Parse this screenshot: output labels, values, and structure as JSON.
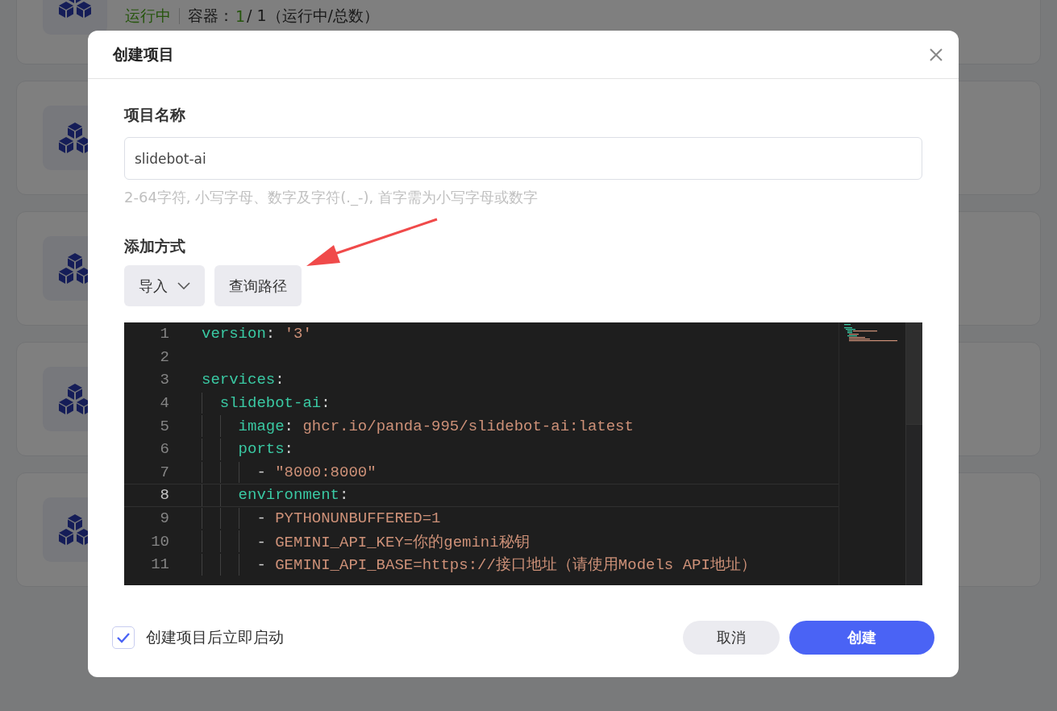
{
  "background": {
    "project_cards": [
      {
        "kind": "status",
        "status": "运行中",
        "containers_label": "容器：",
        "running": "1",
        "total": "/ 1（运行中/总数）"
      },
      {
        "kind": "hidden"
      },
      {
        "kind": "hidden"
      },
      {
        "kind": "hidden"
      },
      {
        "kind": "hidden"
      }
    ]
  },
  "dialog": {
    "title": "创建项目",
    "name_label": "项目名称",
    "name_value": "slidebot-ai",
    "name_hint": "2-64字符, 小写字母、数字及字符(._-), 首字需为小写字母或数字",
    "method_label": "添加方式",
    "import_button": "导入",
    "query_path_button": "查询路径",
    "editor": {
      "lines": [
        {
          "number": "1",
          "current": false,
          "tokens": [
            {
              "text": "version",
              "kind": "key"
            },
            {
              "text": ": ",
              "kind": "punct"
            },
            {
              "text": "'3'",
              "kind": "str"
            }
          ]
        },
        {
          "number": "2",
          "current": false
        },
        {
          "number": "3",
          "current": false,
          "tokens": [
            {
              "text": "services",
              "kind": "key"
            },
            {
              "text": ":",
              "kind": "punct"
            }
          ]
        },
        {
          "number": "4",
          "current": false,
          "tokens": [
            {
              "text": "  slidebot-ai",
              "kind": "key"
            },
            {
              "text": ":",
              "kind": "punct"
            }
          ]
        },
        {
          "number": "5",
          "current": false,
          "tokens": [
            {
              "text": "    image",
              "kind": "key"
            },
            {
              "text": ": ",
              "kind": "punct"
            },
            {
              "text": "ghcr.io/panda-995/slidebot-ai:latest",
              "kind": "str"
            }
          ]
        },
        {
          "number": "6",
          "current": false,
          "tokens": [
            {
              "text": "    ports",
              "kind": "key"
            },
            {
              "text": ":",
              "kind": "punct"
            }
          ]
        },
        {
          "number": "7",
          "current": false,
          "tokens": [
            {
              "text": "      - ",
              "kind": "punct"
            },
            {
              "text": "\"8000:8000\"",
              "kind": "str"
            }
          ]
        },
        {
          "number": "8",
          "current": true,
          "tokens": [
            {
              "text": "    environment",
              "kind": "key"
            },
            {
              "text": ":",
              "kind": "punct"
            }
          ]
        },
        {
          "number": "9",
          "current": false,
          "tokens": [
            {
              "text": "      - ",
              "kind": "punct"
            },
            {
              "text": "PYTHONUNBUFFERED=1",
              "kind": "str"
            }
          ]
        },
        {
          "number": "10",
          "current": false,
          "tokens": [
            {
              "text": "      - ",
              "kind": "punct"
            },
            {
              "text": "GEMINI_API_KEY=你的gemini秘钥",
              "kind": "str"
            }
          ]
        },
        {
          "number": "11",
          "current": false,
          "tokens": [
            {
              "text": "      - ",
              "kind": "punct"
            },
            {
              "text": "GEMINI_API_BASE=https://接口地址（请使用Models API地址）",
              "kind": "str"
            }
          ]
        }
      ]
    },
    "auto_start": {
      "label": "创建项目后立即启动",
      "checked": true
    },
    "cancel_button": "取消",
    "create_button": "创建"
  }
}
